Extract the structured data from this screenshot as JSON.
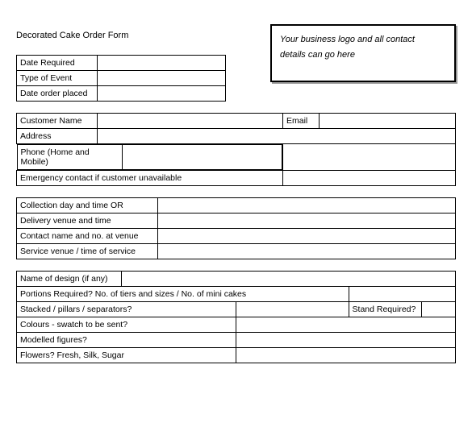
{
  "title": "Decorated Cake Order Form",
  "logo_box": {
    "line1": "Your business logo and all contact",
    "line2": "details can go here"
  },
  "date_section": {
    "date_required": "Date Required",
    "type_of_event": "Type of Event",
    "date_order_placed": "Date order placed"
  },
  "customer": {
    "name": "Customer Name",
    "email": "Email",
    "address": "Address",
    "phone": "Phone (Home and Mobile)",
    "emergency": "Emergency contact if customer unavailable"
  },
  "delivery": {
    "collection": "Collection day and time OR",
    "delivery_venue": "Delivery venue and time",
    "contact_venue": "Contact name and no. at venue",
    "service_venue": "Service venue / time of service"
  },
  "design": {
    "name_of_design": "Name of design (if any)",
    "portions": "Portions Required? No. of tiers and sizes / No. of mini cakes",
    "stacked": "Stacked / pillars / separators?",
    "stand_required": "Stand Required?",
    "colours": "Colours - swatch to be sent?",
    "modelled": "Modelled figures?",
    "flowers": "Flowers? Fresh, Silk, Sugar"
  }
}
